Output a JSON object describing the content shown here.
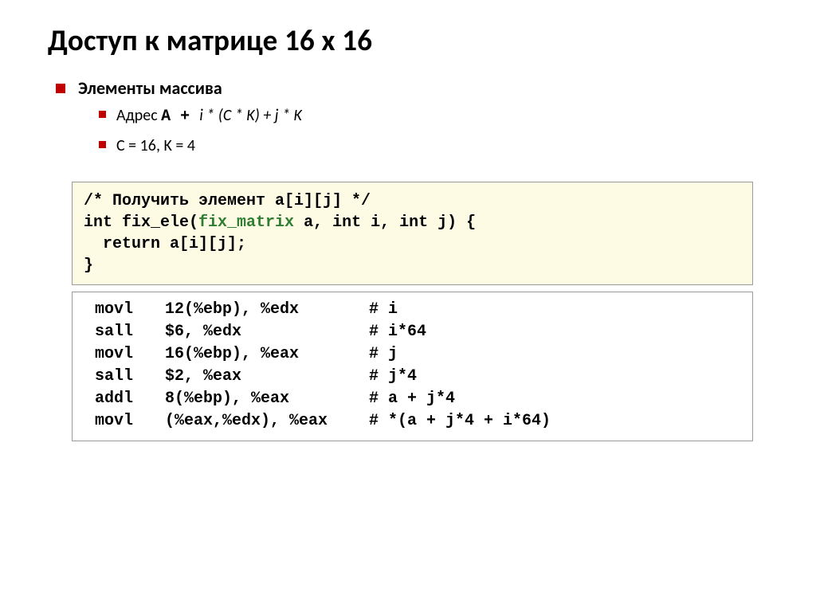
{
  "title": "Доступ к матрице 16 x 16",
  "section_heading": "Элементы массива",
  "bullets": {
    "address_prefix": "Адрес ",
    "address_code": "A + ",
    "address_rest": "i * (C * K) + j * K",
    "constants": "C = 16, K = 4"
  },
  "c_code": {
    "l1": "/* Получить элемент a[i][j] */",
    "l2a": "int fix_ele(",
    "l2type": "fix_matrix",
    "l2b": " a, int i, int j) {",
    "l3": "  return a[i][j];",
    "l4": "}"
  },
  "asm": [
    {
      "op": "movl",
      "args": "12(%ebp), %edx",
      "cmt": "# i"
    },
    {
      "op": "sall",
      "args": "$6, %edx",
      "cmt": "# i*64"
    },
    {
      "op": "movl",
      "args": "16(%ebp), %eax",
      "cmt": "# j"
    },
    {
      "op": "sall",
      "args": "$2, %eax",
      "cmt": "# j*4"
    },
    {
      "op": "addl",
      "args": "8(%ebp), %eax",
      "cmt": "# a + j*4"
    },
    {
      "op": "movl",
      "args": "(%eax,%edx), %eax",
      "cmt": "# *(a + j*4 + i*64)"
    }
  ]
}
